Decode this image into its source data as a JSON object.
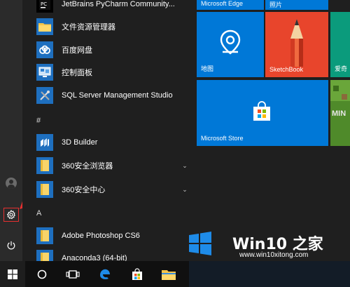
{
  "apps": [
    {
      "label": "JetBrains PyCharm Community...",
      "icon": "pycharm-icon"
    },
    {
      "label": "文件资源管理器",
      "icon": "folder-icon"
    },
    {
      "label": "百度网盘",
      "icon": "cloud-icon"
    },
    {
      "label": "控制面板",
      "icon": "control-panel-icon"
    },
    {
      "label": "SQL Server Management Studio",
      "icon": "sql-server-icon"
    },
    {
      "label": "3D Builder",
      "icon": "3d-builder-icon"
    },
    {
      "label": "360安全浏览器",
      "icon": "folder-icon"
    },
    {
      "label": "360安全中心",
      "icon": "folder-icon"
    },
    {
      "label": "Adobe Photoshop CS6",
      "icon": "photoshop-icon"
    },
    {
      "label": "Anaconda3 (64-bit)",
      "icon": "folder-icon"
    }
  ],
  "section_hash": "#",
  "section_a": "A",
  "tiles": {
    "edge": "Microsoft Edge",
    "photos": "照片",
    "maps": "地图",
    "sketchbook": "SketchBook",
    "partial": "爱奇",
    "store": "Microsoft Store",
    "minecraft_partial": "MIN"
  },
  "watermark": {
    "title_win": "Win10",
    "title_rest": " 之家",
    "url": "www.win10xitong.com"
  },
  "colors": {
    "tile_blue": "#0078d7",
    "sketchbook_orange": "#e8452c",
    "highlight_red": "#e53030"
  }
}
